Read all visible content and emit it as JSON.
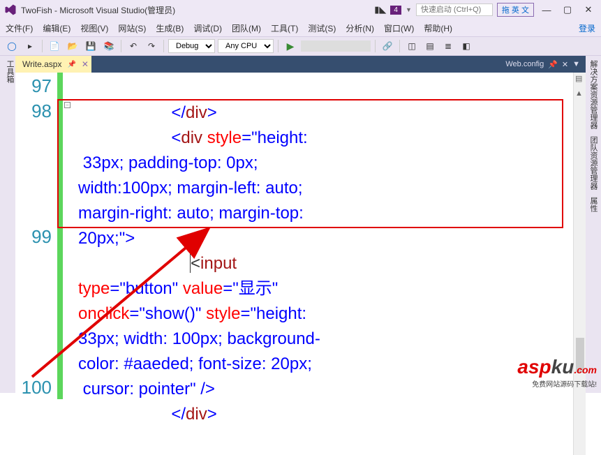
{
  "window": {
    "title": "TwoFish - Microsoft Visual Studio(管理员)",
    "notification_count": "4",
    "search_placeholder": "快速启动 (Ctrl+Q)",
    "ime_label": "拖 英 文",
    "login_label": "登录"
  },
  "menu": {
    "file": "文件(F)",
    "edit": "编辑(E)",
    "view": "视图(V)",
    "website": "网站(S)",
    "build": "生成(B)",
    "debug": "调试(D)",
    "team": "团队(M)",
    "tools": "工具(T)",
    "test": "测试(S)",
    "analyze": "分析(N)",
    "window": "窗口(W)",
    "help": "帮助(H)"
  },
  "toolbar": {
    "config": "Debug",
    "platform": "Any CPU"
  },
  "dock": {
    "left": "工具箱",
    "r1": "解决方案资源管理器",
    "r2": "团队资源管理器",
    "r3": "属性"
  },
  "tabs": {
    "active": "Write.aspx",
    "right": "Web.config"
  },
  "lines": {
    "l97": "97",
    "l98": "98",
    "l99": "99",
    "l100": "100"
  },
  "code": {
    "l97": "                    </div>",
    "l98a": "                    <div style=\"height:",
    "l98b": " 33px; padding-top: 0px;",
    "l98c": "width:100px; margin-left: auto;",
    "l98d": "margin-right: auto; margin-top:",
    "l98e": "20px;\">",
    "l99a": "                        <input",
    "l99b": "type=\"button\" value=\"显示\"",
    "l99c": "onclick=\"show()\" style=\"height:",
    "l99d": "33px; width: 100px; background-",
    "l99e": "color: #aaeded; font-size: 20px;",
    "l99f": " cursor: pointer\" />",
    "l100": "                    </div>"
  },
  "watermark": {
    "brand1": "asp",
    "brand2": "ku",
    "tld": ".com",
    "sub": "免费网站源码下载站!"
  }
}
